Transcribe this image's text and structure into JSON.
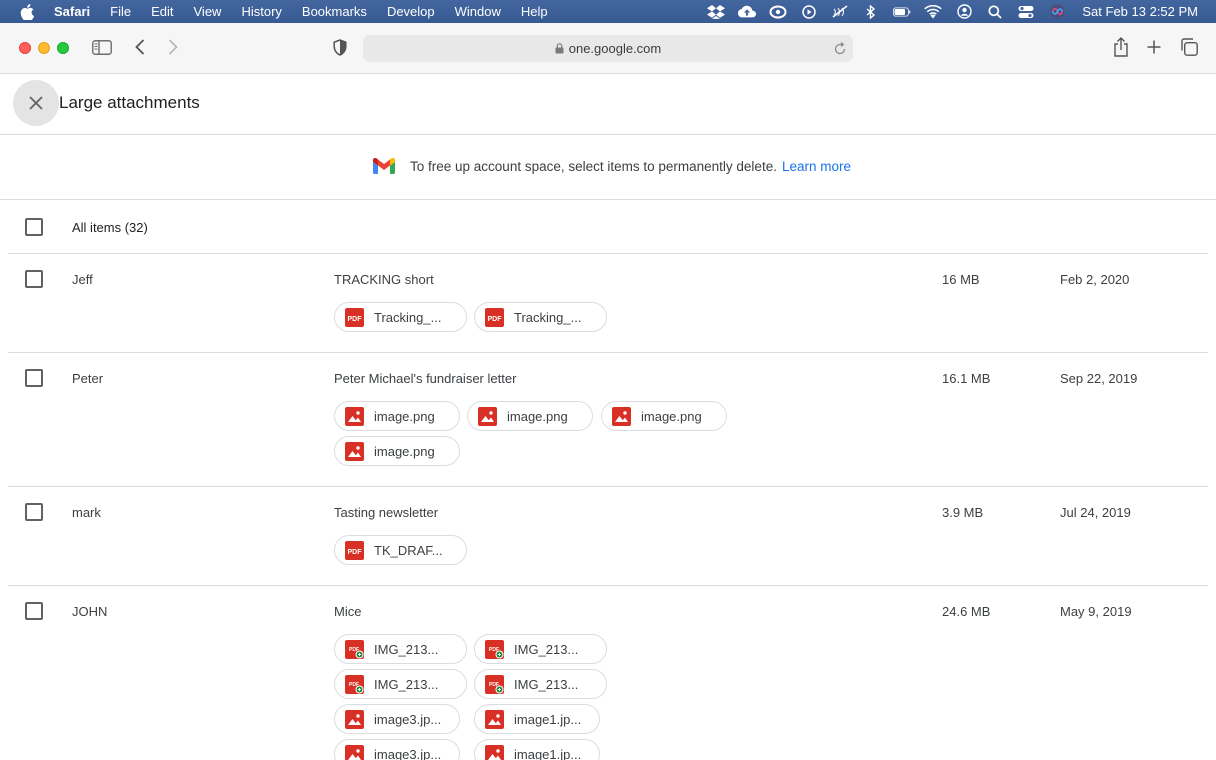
{
  "menubar": {
    "items": [
      "Safari",
      "File",
      "Edit",
      "View",
      "History",
      "Bookmarks",
      "Develop",
      "Window",
      "Help"
    ],
    "clock": "Sat Feb 13  2:52 PM"
  },
  "browser": {
    "url": "one.google.com"
  },
  "page": {
    "title": "Large attachments",
    "banner_text": "To free up account space, select items to permanently delete.",
    "learn_more": "Learn more",
    "all_items_label": "All items (32)"
  },
  "rows": [
    {
      "sender": "Jeff",
      "subject": "TRACKING short",
      "size": "16 MB",
      "date": "Feb 2, 2020",
      "attachments": [
        {
          "name": "Tracking_...",
          "icon": "pdf-icon"
        },
        {
          "name": "Tracking_...",
          "icon": "pdf-icon"
        }
      ]
    },
    {
      "sender": "Peter",
      "subject": "Peter Michael's fundraiser letter",
      "size": "16.1 MB",
      "date": "Sep 22, 2019",
      "attachments": [
        {
          "name": "image.png",
          "icon": "image-icon"
        },
        {
          "name": "image.png",
          "icon": "image-icon"
        },
        {
          "name": "image.png",
          "icon": "image-icon"
        },
        {
          "name": "image.png",
          "icon": "image-icon"
        }
      ]
    },
    {
      "sender": "mark",
      "subject": "Tasting newsletter",
      "size": "3.9 MB",
      "date": "Jul 24, 2019",
      "attachments": [
        {
          "name": "TK_DRAF...",
          "icon": "pdf-icon"
        }
      ]
    },
    {
      "sender": "JOHN",
      "subject": "Mice",
      "size": "24.6 MB",
      "date": "May 9, 2019",
      "attachments": [
        {
          "name": "IMG_213...",
          "icon": "pdf-doc-icon"
        },
        {
          "name": "IMG_213...",
          "icon": "pdf-doc-icon"
        },
        {
          "name": "IMG_213...",
          "icon": "pdf-doc-icon"
        },
        {
          "name": "IMG_213...",
          "icon": "pdf-doc-icon"
        },
        {
          "name": "image3.jp...",
          "icon": "image-icon"
        },
        {
          "name": "image1.jp...",
          "icon": "image-icon"
        },
        {
          "name": "image3.jp...",
          "icon": "image-icon"
        },
        {
          "name": "image1.jp...",
          "icon": "image-icon"
        }
      ]
    }
  ],
  "colors": {
    "accent_link": "#1a73e8",
    "file_icon_red": "#d93025",
    "divider": "#dadce0"
  }
}
